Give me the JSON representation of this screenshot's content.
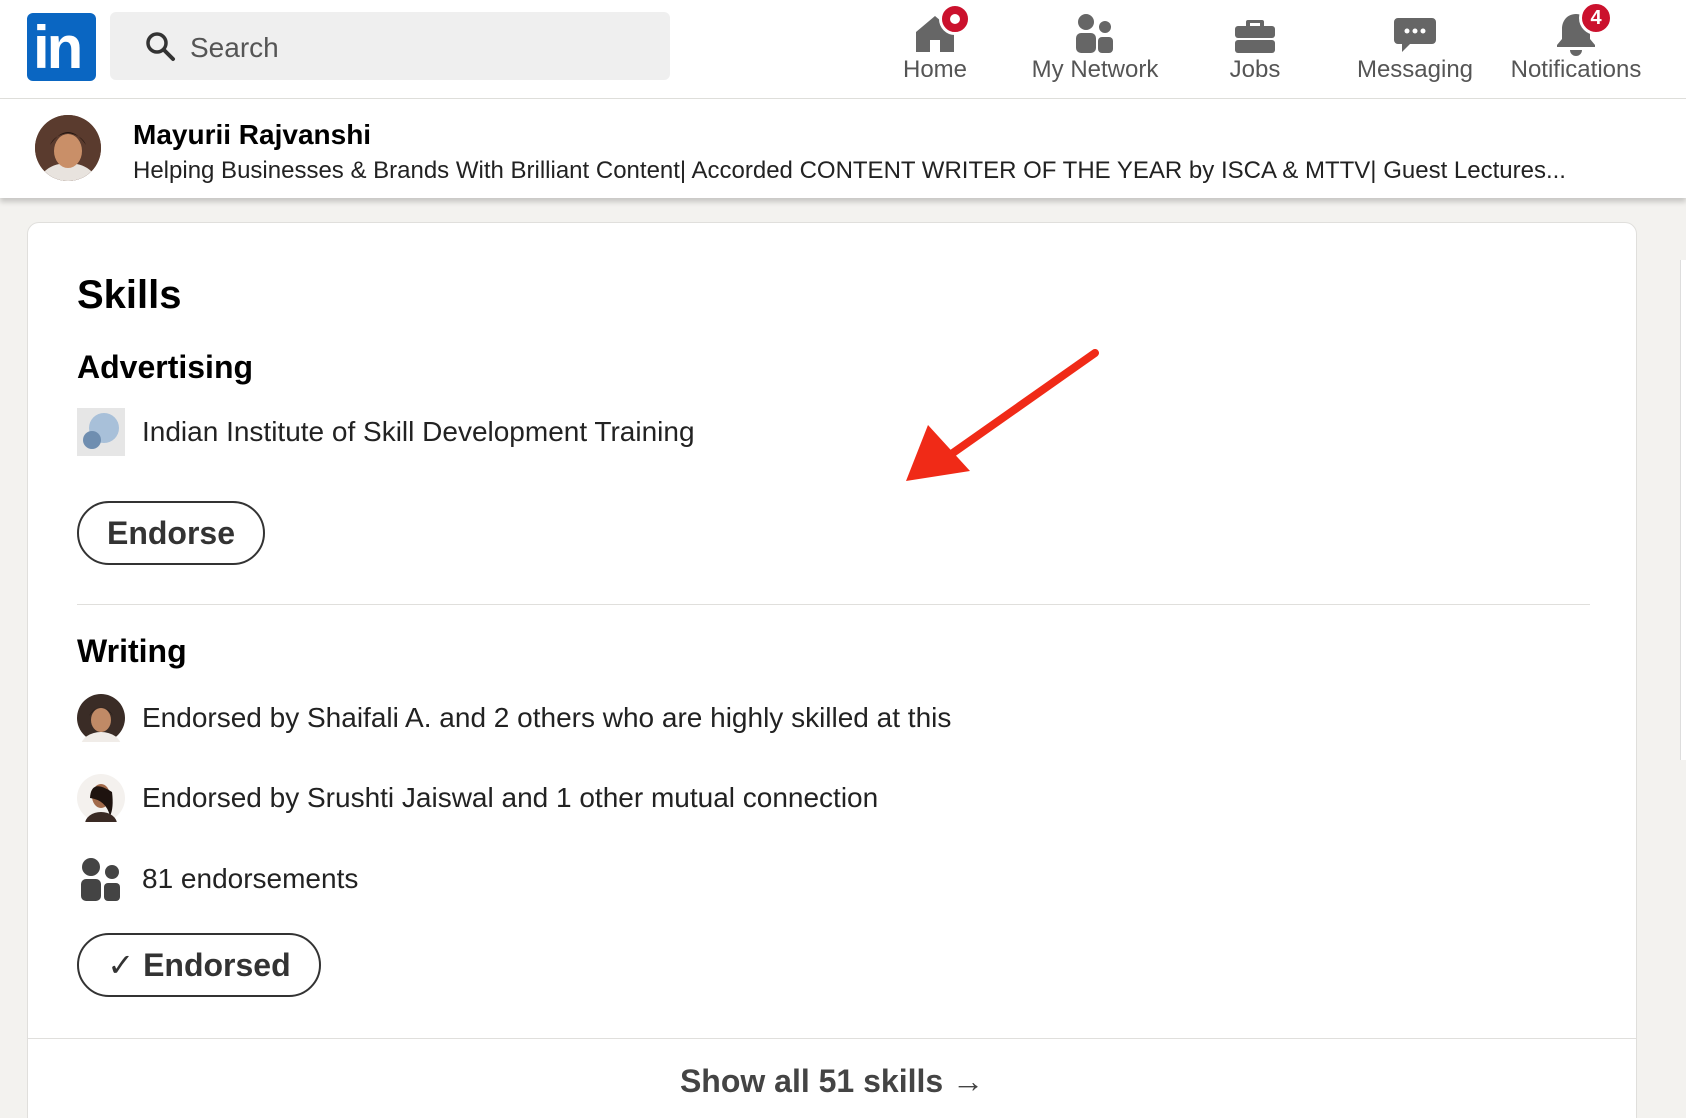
{
  "nav": {
    "logo_text": "in",
    "search_placeholder": "Search",
    "items": [
      {
        "label": "Home",
        "icon": "home-icon",
        "badge": "dot"
      },
      {
        "label": "My Network",
        "icon": "people-icon"
      },
      {
        "label": "Jobs",
        "icon": "briefcase-icon"
      },
      {
        "label": "Messaging",
        "icon": "chat-icon"
      },
      {
        "label": "Notifications",
        "icon": "bell-icon",
        "badge": "4"
      }
    ]
  },
  "profile": {
    "name": "Mayurii Rajvanshi",
    "headline": "Helping Businesses & Brands With Brilliant Content| Accorded CONTENT WRITER OF THE YEAR by ISCA & MTTV| Guest Lectures..."
  },
  "skills": {
    "title": "Skills",
    "items": [
      {
        "name": "Advertising",
        "detail": "Indian Institute of Skill Development Training",
        "button": "Endorse"
      },
      {
        "name": "Writing",
        "endorsement_1": "Endorsed by Shaifali A. and 2 others who are highly skilled at this",
        "endorsement_2": "Endorsed by Srushti Jaiswal and 1 other mutual connection",
        "count": "81 endorsements",
        "button": "Endorsed"
      }
    ],
    "show_all": "Show all 51 skills"
  },
  "colors": {
    "brand": "#0a66c2",
    "badge": "#cb112d",
    "annotation_arrow": "#f02a17"
  }
}
